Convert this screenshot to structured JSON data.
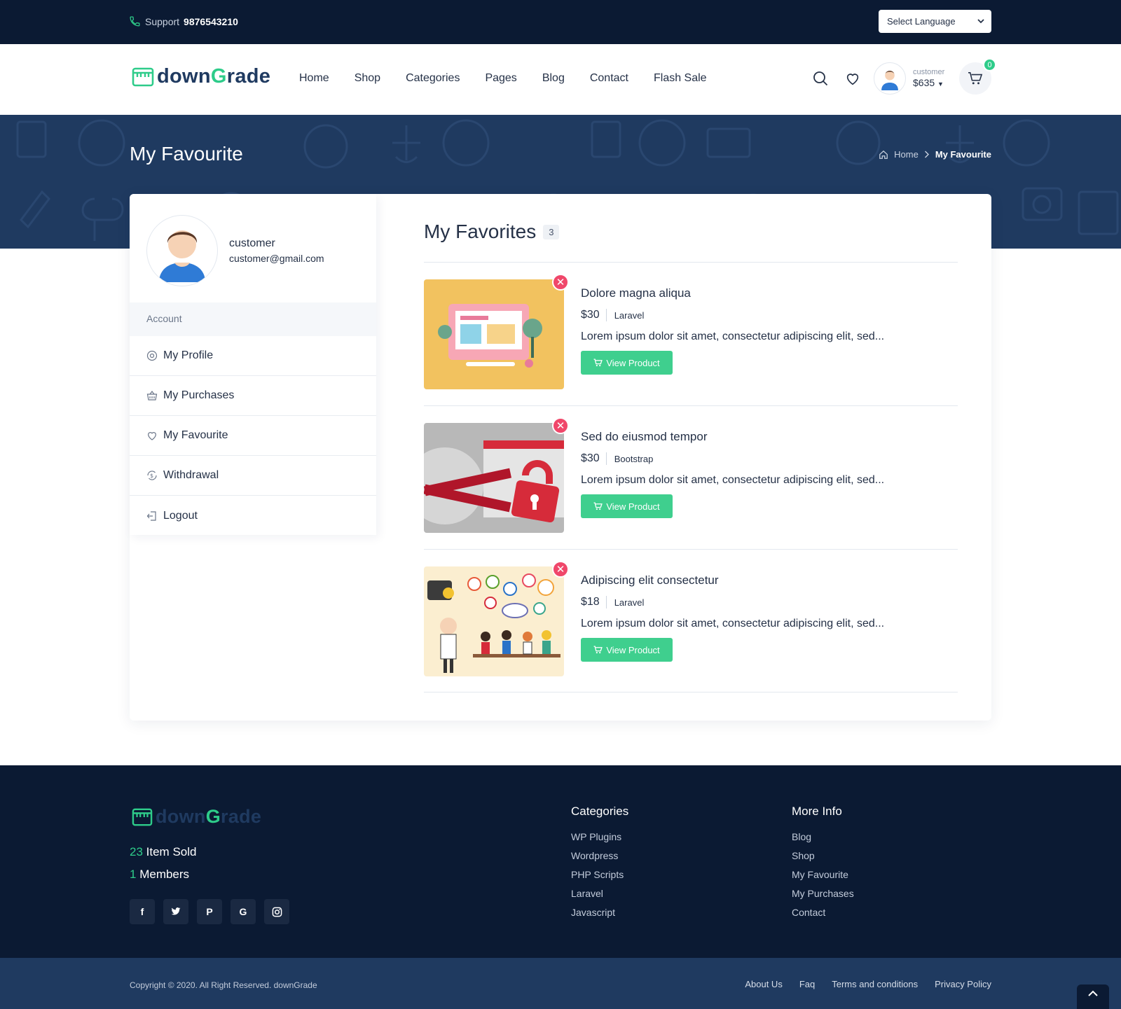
{
  "topbar": {
    "support_label": "Support",
    "support_phone": "9876543210",
    "language": "Select Language"
  },
  "header": {
    "logo": {
      "part1": "down",
      "part2": "G",
      "part3": "rade"
    },
    "nav": [
      "Home",
      "Shop",
      "Categories",
      "Pages",
      "Blog",
      "Contact",
      "Flash Sale"
    ],
    "user": {
      "name": "customer",
      "balance": "$635"
    },
    "cart_count": "0"
  },
  "banner": {
    "title": "My Favourite",
    "breadcrumb": {
      "home": "Home",
      "current": "My Favourite"
    }
  },
  "sidebar": {
    "profile": {
      "name": "customer",
      "email": "customer@gmail.com"
    },
    "section_label": "Account",
    "items": [
      {
        "label": "My Profile",
        "icon": "gear-icon"
      },
      {
        "label": "My Purchases",
        "icon": "basket-icon"
      },
      {
        "label": "My Favourite",
        "icon": "heart-icon"
      },
      {
        "label": "Withdrawal",
        "icon": "dollar-refresh-icon"
      },
      {
        "label": "Logout",
        "icon": "logout-icon"
      }
    ]
  },
  "favorites": {
    "title": "My Favorites",
    "count": "3",
    "items": [
      {
        "title": "Dolore magna aliqua",
        "price": "$30",
        "category": "Laravel",
        "description": "Lorem ipsum dolor sit amet, consectetur adipiscing elit, sed...",
        "button": "View Product"
      },
      {
        "title": "Sed do eiusmod tempor",
        "price": "$30",
        "category": "Bootstrap",
        "description": "Lorem ipsum dolor sit amet, consectetur adipiscing elit, sed...",
        "button": "View Product"
      },
      {
        "title": "Adipiscing elit consectetur",
        "price": "$18",
        "category": "Laravel",
        "description": "Lorem ipsum dolor sit amet, consectetur adipiscing elit, sed...",
        "button": "View Product"
      }
    ]
  },
  "footer": {
    "items_sold": {
      "count": "23",
      "label": "Item Sold"
    },
    "members": {
      "count": "1",
      "label": "Members"
    },
    "socials": [
      "facebook-icon",
      "twitter-icon",
      "pinterest-icon",
      "google-icon",
      "instagram-icon"
    ],
    "categories": {
      "title": "Categories",
      "links": [
        "WP Plugins",
        "Wordpress",
        "PHP Scripts",
        "Laravel",
        "Javascript"
      ]
    },
    "more_info": {
      "title": "More Info",
      "links": [
        "Blog",
        "Shop",
        "My Favourite",
        "My Purchases",
        "Contact"
      ]
    },
    "copyright": "Copyright © 2020. All Right Reserved. downGrade",
    "bottom_links": [
      "About Us",
      "Faq",
      "Terms and conditions",
      "Privacy Policy"
    ]
  },
  "colors": {
    "navy": "#0b1a33",
    "brand_blue": "#1f3a60",
    "accent_green": "#2ecc8a",
    "remove_red": "#f0476a"
  }
}
